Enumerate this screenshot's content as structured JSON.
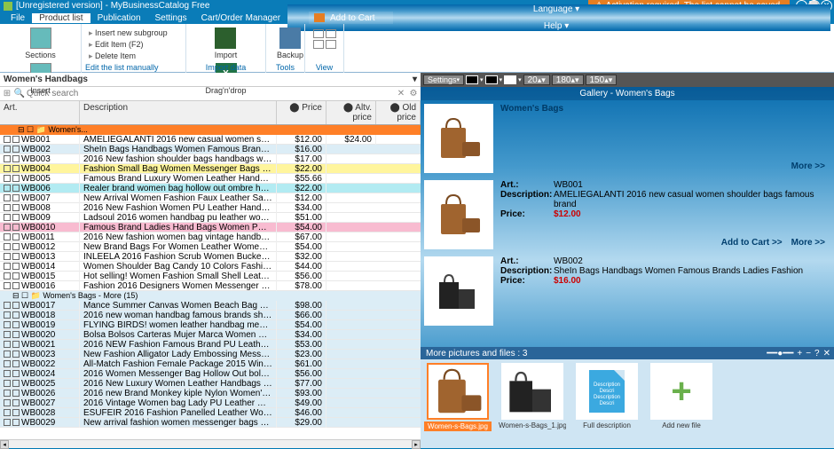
{
  "title": "[Unregistered version] - MyBusinessCatalog Free",
  "warning": "Activation required. The list cannot be saved.",
  "menubar": {
    "items": [
      "File",
      "Product list",
      "Publication",
      "Settings",
      "Cart/Order Manager"
    ],
    "active": 1,
    "addcart": "Add to Cart",
    "language": "Language",
    "help": "Help"
  },
  "ribbon": {
    "sections": "Sections",
    "insert": "Insert",
    "items": [
      "Insert new subgroup",
      "Edit Item  (F2)",
      "Delete Item"
    ],
    "edit_list": "Edit the list manually",
    "import": "Import",
    "dnd": "Drag'n'drop",
    "backup": "Backup",
    "g_import": "Import data",
    "g_tools": "Tools",
    "g_view": "View"
  },
  "category": "Women's Handbags",
  "search_ph": "Quick search",
  "cols": {
    "art": "Art.",
    "desc": "Description",
    "price": "Price",
    "alt": "Altv. price",
    "old": "Old price"
  },
  "section_main": "Women's...",
  "rows": [
    {
      "a": "WB001",
      "d": "AMELIEGALANTI 2016 new casual women shoul...",
      "p": "$12.00",
      "alt": "$24.00",
      "c": ""
    },
    {
      "a": "WB002",
      "d": "SheIn Bags Handbags Women Famous Brands ...",
      "p": "$16.00",
      "c": "hl-blue"
    },
    {
      "a": "WB003",
      "d": "2016 New fashion shoulder bags handbags wom...",
      "p": "$17.00",
      "c": ""
    },
    {
      "a": "WB004",
      "d": "Fashion Small Bag Women Messenger Bags Sof...",
      "p": "$22.00",
      "c": "hl-yellow"
    },
    {
      "a": "WB005",
      "d": "Famous Brand Luxury Women Leather Handbag...",
      "p": "$55.66",
      "c": ""
    },
    {
      "a": "WB006",
      "d": "Realer brand women bag hollow out ombre handb...",
      "p": "$22.00",
      "c": "hl-cyan"
    },
    {
      "a": "WB007",
      "d": "New Arrival Women Fashion Faux Leather Satch...",
      "p": "$12.00",
      "c": ""
    },
    {
      "a": "WB008",
      "d": "2016 New Fashion Women PU Leather Handbag ...",
      "p": "$34.00",
      "c": ""
    },
    {
      "a": "WB009",
      "d": "Ladsoul 2016 women handbag pu leather women ...",
      "p": "$51.00",
      "c": ""
    },
    {
      "a": "WB0010",
      "d": "Famous Brand Ladies Hand Bags Women PU Le...",
      "p": "$54.00",
      "c": "hl-pink"
    },
    {
      "a": "WB0011",
      "d": "2016 New fashion women bag vintage handbags ...",
      "p": "$67.00",
      "c": ""
    },
    {
      "a": "WB0012",
      "d": "New Brand Bags For Women Leather Women M...",
      "p": "$54.00",
      "c": ""
    },
    {
      "a": "WB0013",
      "d": "INLEELA 2016 Fashion Scrub Women Bucket B...",
      "p": "$32.00",
      "c": ""
    },
    {
      "a": "WB0014",
      "d": "Women Shoulder Bag Candy 10 Colors Fashion ...",
      "p": "$44.00",
      "c": ""
    },
    {
      "a": "WB0015",
      "d": "Hot selling! Women Fashion Small Shell Leather ...",
      "p": "$56.00",
      "c": ""
    },
    {
      "a": "WB0016",
      "d": "Fashion 2016 Designers Women Messenger Bag...",
      "p": "$78.00",
      "c": ""
    }
  ],
  "section_more": "Women's Bags - More  (15)",
  "rows2": [
    {
      "a": "WB0017",
      "d": "Mance Summer Canvas Women Beach Bag Fas...",
      "p": "$98.00"
    },
    {
      "a": "WB0018",
      "d": "2016 new woman handbag famous brands should...",
      "p": "$66.00"
    },
    {
      "a": "WB0019",
      "d": "FLYING BIRDS! women leather handbag messen...",
      "p": "$54.00"
    },
    {
      "a": "WB0020",
      "d": "Bolsa Bolsos Carteras Mujer Marca Women PU ...",
      "p": "$34.00"
    },
    {
      "a": "WB0021",
      "d": "2016 NEW Fashion Famous Brand PU Leather ...",
      "p": "$53.00"
    },
    {
      "a": "WB0023",
      "d": "New Fashion Alligator Lady Embossing Messeng...",
      "p": "$23.00"
    },
    {
      "a": "WB0022",
      "d": "All-Match Fashion Female Package 2015 Winter...",
      "p": "$61.00"
    },
    {
      "a": "WB0024",
      "d": "2016 Women Messenger Bag Hollow Out bolsa f...",
      "p": "$56.00"
    },
    {
      "a": "WB0025",
      "d": "2016 New Luxury Women Leather Handbags Riv...",
      "p": "$77.00"
    },
    {
      "a": "WB0026",
      "d": "2016 new Brand Monkey kiple Nylon Women's B...",
      "p": "$93.00"
    },
    {
      "a": "WB0027",
      "d": "2016 Vintage Women bag Lady PU Leather Cros...",
      "p": "$49.00"
    },
    {
      "a": "WB0028",
      "d": "ESUFEIR 2016 Fashion Panelled Leather Wome...",
      "p": "$46.00"
    },
    {
      "a": "WB0029",
      "d": "New arrival fashion women messenger bags shou...",
      "p": "$29.00"
    }
  ],
  "settingsbtn": "Settings",
  "spinvals": [
    "20",
    "180",
    "150"
  ],
  "gallery_title": "Gallery - Women's Bags",
  "gitems": [
    {
      "title": "Women's Bags",
      "art": "",
      "desc": "",
      "price": "",
      "more": "More >>",
      "addcart": ""
    },
    {
      "title": "",
      "art": "WB001",
      "artl": "Art.:",
      "descl": "Description:",
      "desc": "AMELIEGALANTI 2016 new casual women shoulder bags famous brand",
      "pricel": "Price:",
      "price": "$12.00",
      "more": "More >>",
      "addcart": "Add to Cart >>"
    },
    {
      "title": "",
      "art": "WB002",
      "artl": "Art.:",
      "descl": "Description:",
      "desc": "SheIn Bags Handbags Women Famous Brands Ladies Fashion",
      "pricel": "Price:",
      "price": "$16.00",
      "more": "",
      "addcart": ""
    }
  ],
  "thumbs_hdr": "More pictures and files :  3",
  "thumbs": [
    {
      "lbl": "Women-s-Bags.jpg",
      "type": "img",
      "sel": true
    },
    {
      "lbl": "Women-s-Bags_1.jpg",
      "type": "img"
    },
    {
      "lbl": "Full description",
      "type": "doc",
      "txt": "Description Descri Description Descri"
    },
    {
      "lbl": "Add new file",
      "type": "add"
    }
  ]
}
